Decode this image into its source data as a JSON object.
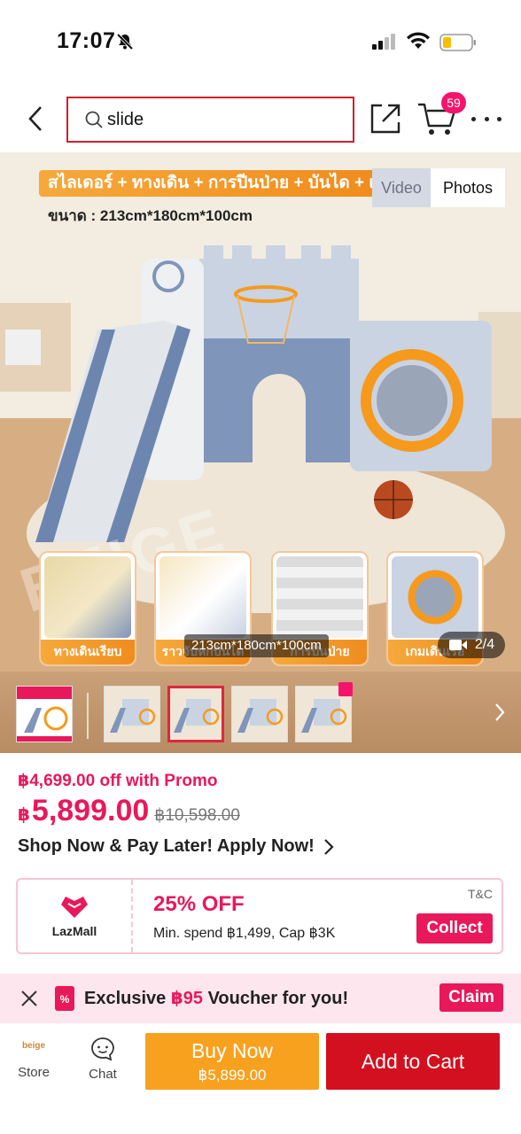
{
  "status_bar": {
    "time": "17:07"
  },
  "header": {
    "search_value": "slide",
    "cart_count": "59"
  },
  "gallery": {
    "banner_text": "สไลเดอร์ + ทางเดิน + การปีนป่าย + บันได + เร",
    "size_text": "ขนาด : 213cm*180cm*100cm",
    "tabs": {
      "video": "Video",
      "photos": "Photos",
      "active": "Photos"
    },
    "watermark": "BEIGE",
    "features": [
      {
        "label": "ทางเดินเรียบ"
      },
      {
        "label": "ราวจับหกบันได"
      },
      {
        "label": "การปีนป่าย"
      },
      {
        "label": "เกมเดินเรือ"
      }
    ],
    "dimension_pill": "213cm*180cm*100cm",
    "counter": "2/4",
    "selected_thumb": 2
  },
  "price": {
    "promo_line": "฿4,699.00 off with Promo",
    "currency": "฿",
    "current": "5,899.00",
    "original": "฿10,598.00",
    "pay_later": "Shop Now & Pay Later! Apply Now!"
  },
  "voucher": {
    "store_label": "LazMall",
    "discount": "25% OFF",
    "conditions": "Min. spend ฿1,499, Cap ฿3K",
    "tc": "T&C",
    "collect": "Collect"
  },
  "exclusive": {
    "prefix": "Exclusive ",
    "amount": "฿95",
    "suffix": " Voucher for you!",
    "claim": "Claim"
  },
  "bottom_bar": {
    "store_logo": "beige",
    "store": "Store",
    "chat": "Chat",
    "buy_now": "Buy Now",
    "buy_now_price": "฿5,899.00",
    "add_to_cart": "Add to Cart"
  },
  "colors": {
    "brand_pink": "#e8185b",
    "cart_red": "#d2101f",
    "buy_orange": "#f8a11e",
    "search_border": "#d21f2a"
  }
}
